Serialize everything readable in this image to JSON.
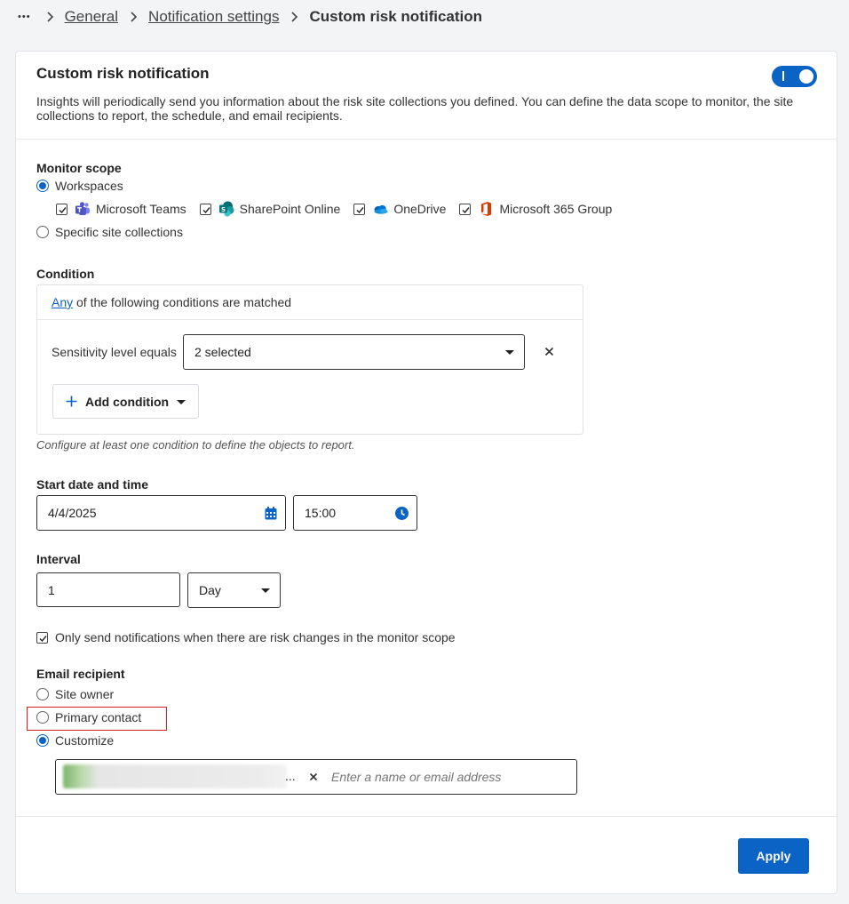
{
  "breadcrumb": {
    "more": "•••",
    "items": [
      "General",
      "Notification settings"
    ],
    "current": "Custom risk notification"
  },
  "card": {
    "title": "Custom risk notification",
    "description": "Insights will periodically send you information about the risk site collections you defined. You can define the data scope to monitor, the site collections to report, the schedule, and email recipients.",
    "toggle": {
      "on": true
    }
  },
  "monitor_scope": {
    "label": "Monitor scope",
    "workspaces": "Workspaces",
    "apps": [
      "Microsoft Teams",
      "SharePoint Online",
      "OneDrive",
      "Microsoft 365 Group"
    ],
    "specific": "Specific site collections"
  },
  "condition": {
    "label": "Condition",
    "any": "Any",
    "matched_text": " of the following conditions are matched",
    "rule_label": "Sensitivity level equals",
    "rule_value": "2 selected",
    "add_label": "Add condition",
    "hint": "Configure at least one condition to define the objects to report."
  },
  "schedule": {
    "label": "Start date and time",
    "date": "4/4/2025",
    "time": "15:00"
  },
  "interval": {
    "label": "Interval",
    "value": "1",
    "unit": "Day"
  },
  "only_changes": "Only send notifications when there are risk changes in the monitor scope",
  "email": {
    "label": "Email recipient",
    "options": [
      "Site owner",
      "Primary contact",
      "Customize"
    ],
    "selected": "Customize",
    "chip_ellipsis": "...",
    "placeholder": "Enter a name or email address"
  },
  "apply_label": "Apply",
  "colors": {
    "accent": "#0b63c6",
    "highlight": "#d32020"
  }
}
